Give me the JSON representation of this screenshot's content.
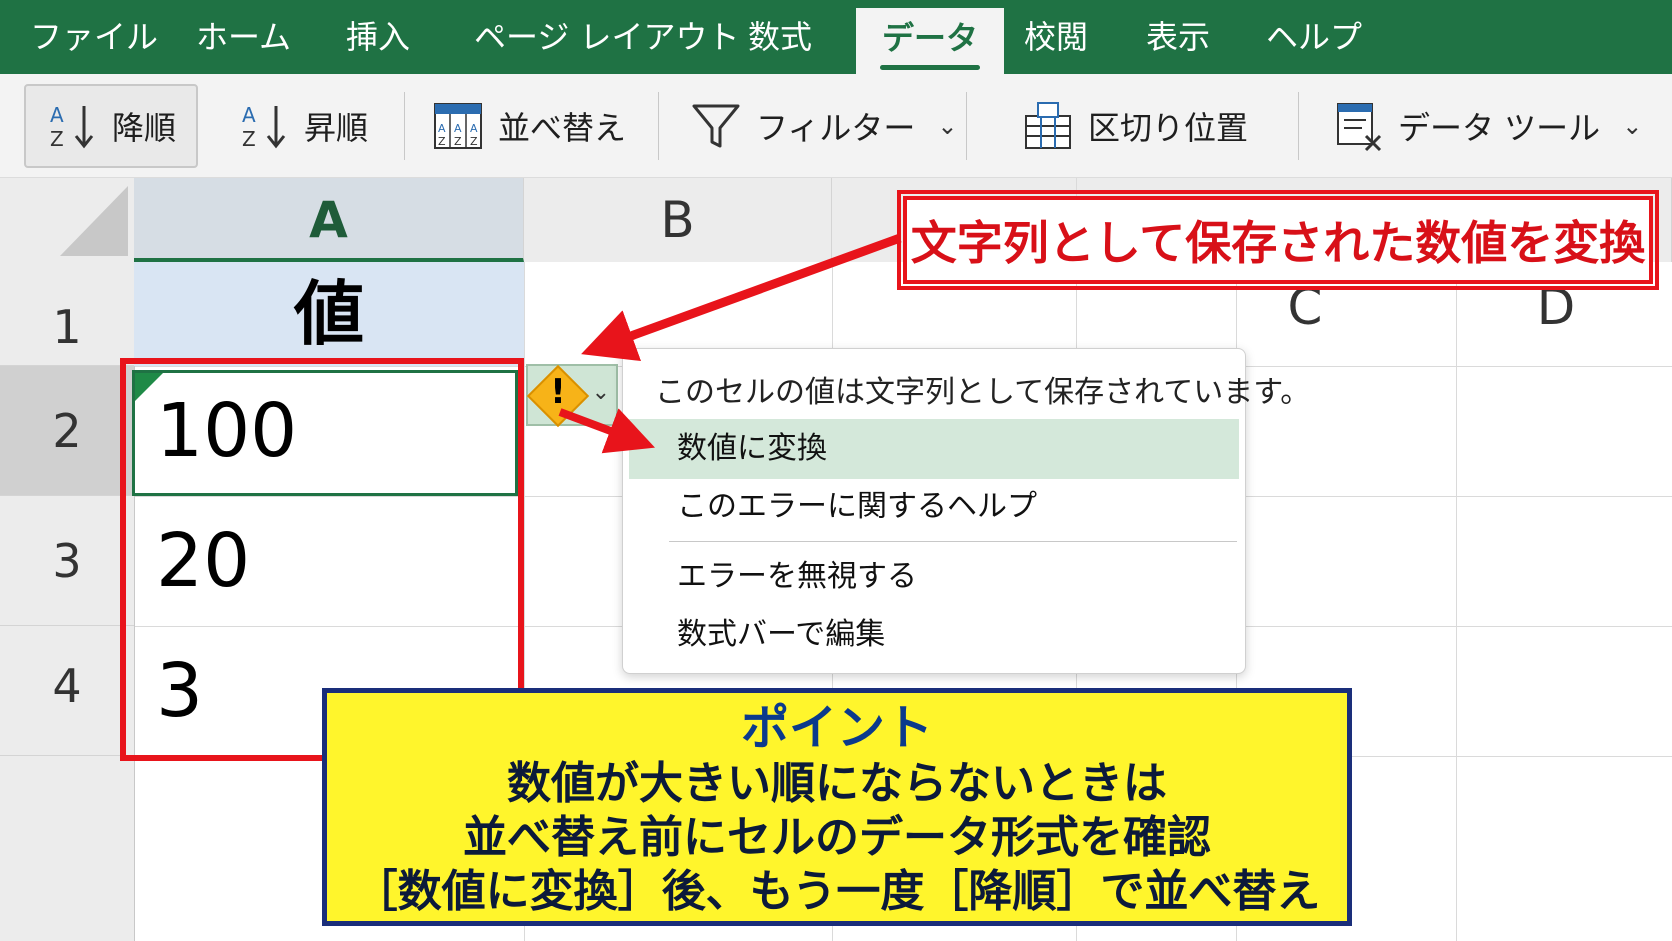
{
  "menubar": {
    "tabs": [
      {
        "label": "ファイル"
      },
      {
        "label": "ホーム"
      },
      {
        "label": "挿入"
      },
      {
        "label": "ページ レイアウト"
      },
      {
        "label": "数式"
      },
      {
        "label": "データ"
      },
      {
        "label": "校閲"
      },
      {
        "label": "表示"
      },
      {
        "label": "ヘルプ"
      }
    ]
  },
  "ribbon": {
    "sort_desc": "降順",
    "sort_asc": "昇順",
    "sort": "並べ替え",
    "filter": "フィルター",
    "text_to_columns": "区切り位置",
    "data_tools": "データ ツール"
  },
  "grid": {
    "columns": [
      "A",
      "B",
      "C",
      "D"
    ],
    "rows": [
      "1",
      "2",
      "3",
      "4"
    ],
    "header_value": "値",
    "values": [
      "100",
      "20",
      "3"
    ]
  },
  "context_menu": {
    "title": "このセルの値は文字列として保存されています。",
    "items": [
      {
        "label": "数値に変換"
      },
      {
        "label": "このエラーに関するヘルプ"
      },
      {
        "label": "エラーを無視する"
      },
      {
        "label": "数式バーで編集"
      }
    ]
  },
  "callout": {
    "text": "文字列として保存された数値を変換"
  },
  "point": {
    "title": "ポイント",
    "lines": [
      "数値が大きい順にならないときは",
      "並べ替え前にセルのデータ形式を確認",
      "［数値に変換］後、もう一度［降順］で並べ替え"
    ]
  },
  "colors": {
    "excel_green": "#1f7244",
    "highlight_red": "#e8141b",
    "point_yellow": "#fff52c",
    "point_border": "#1a2e7a"
  }
}
